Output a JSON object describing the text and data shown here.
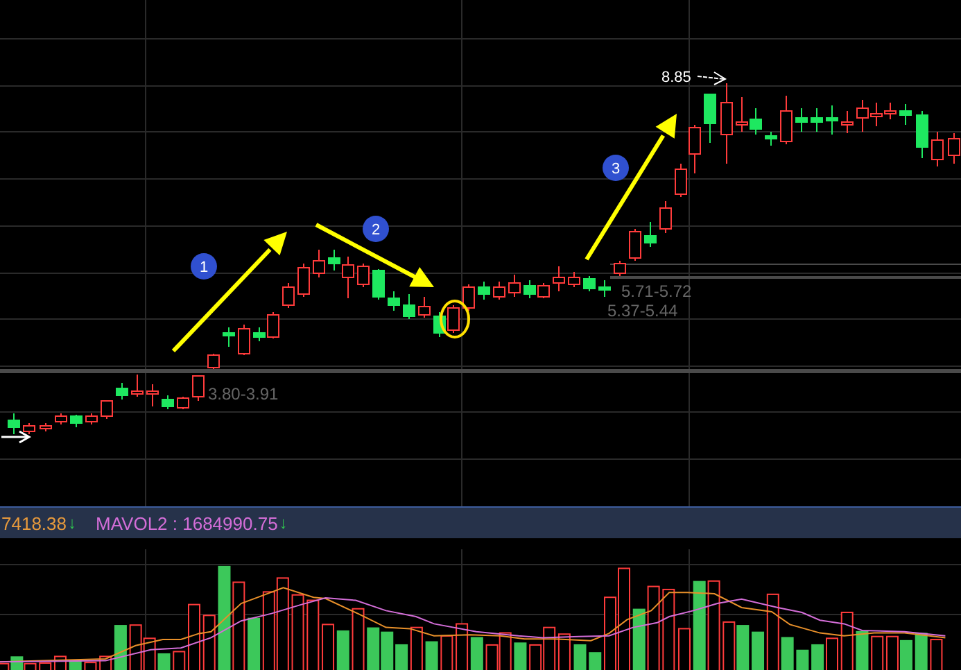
{
  "price_chart": {
    "price_labels": [
      {
        "text": "8.85"
      },
      {
        "text": "3.80-3.91"
      },
      {
        "text": "5.71-5.72"
      },
      {
        "text": "5.37-5.44"
      }
    ],
    "step_markers": [
      {
        "text": "1"
      },
      {
        "text": "2"
      },
      {
        "text": "3"
      }
    ]
  },
  "volume_legend": [
    {
      "text": "7418.38",
      "trend": "↓",
      "color": "#e89a3c"
    },
    {
      "text": "MAVOL2 : 1684990.75",
      "trend": "↓",
      "color": "#d46ed8"
    }
  ]
}
